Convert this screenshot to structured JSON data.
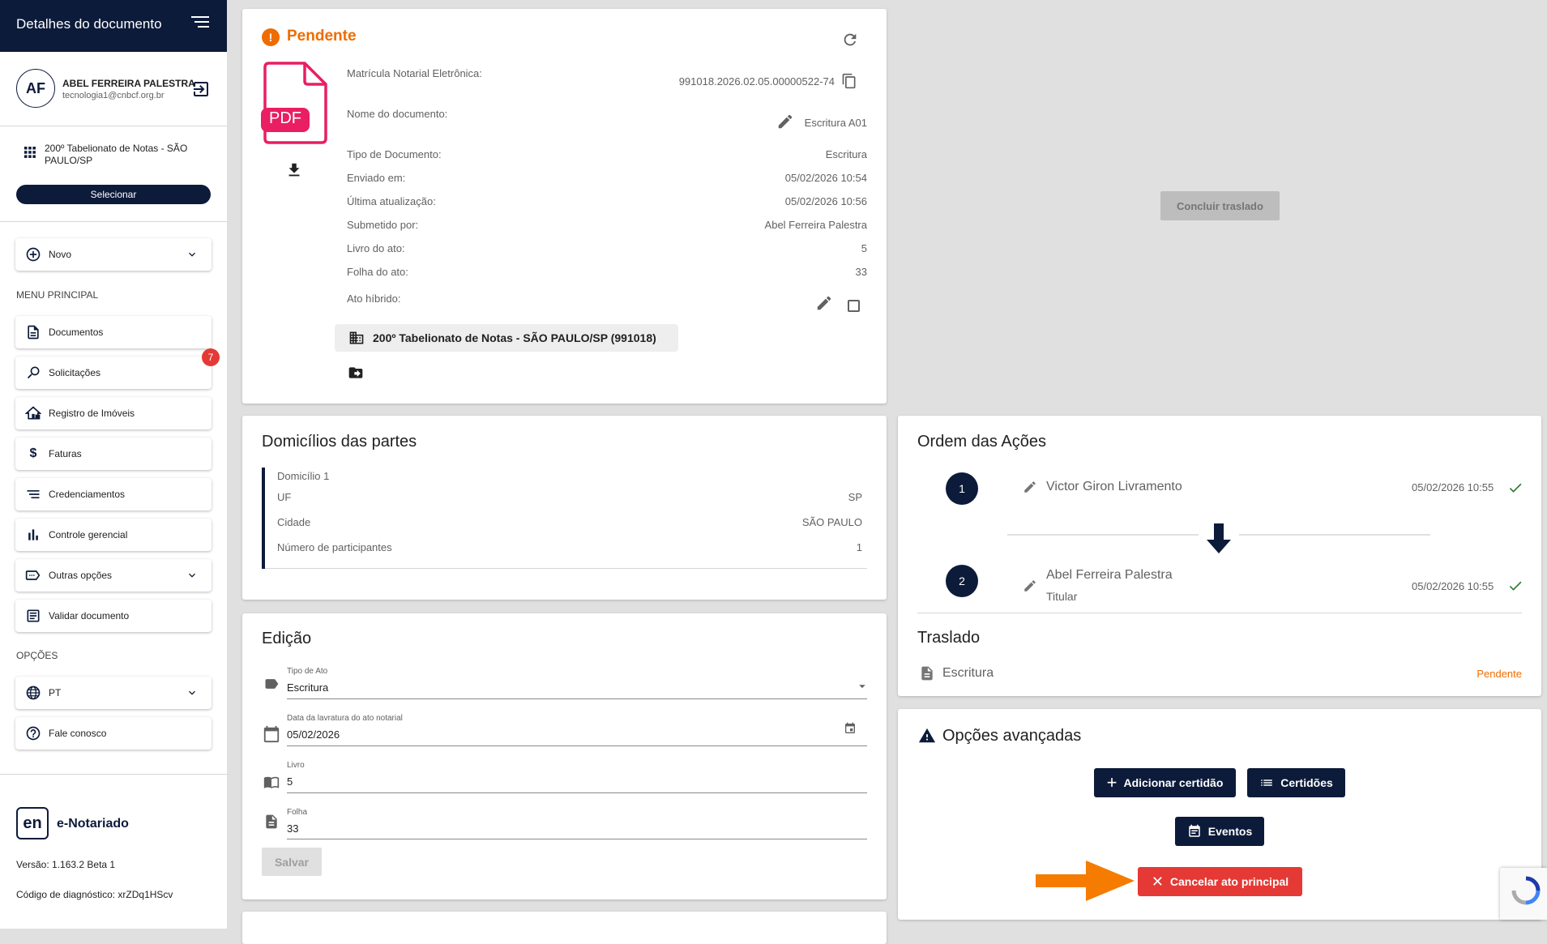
{
  "sidebar": {
    "title": "Detalhes do documento",
    "user": {
      "initials": "AF",
      "name": "ABEL FERREIRA PALESTRA",
      "email": "tecnologia1@cnbcf.org.br"
    },
    "office": "200º Tabelionato de Notas - SÃO PAULO/SP",
    "select_label": "Selecionar",
    "new_label": "Novo",
    "menu_heading": "MENU PRINCIPAL",
    "menu": [
      {
        "label": "Documentos"
      },
      {
        "label": "Solicitações",
        "badge": "7"
      },
      {
        "label": "Registro de Imóveis"
      },
      {
        "label": "Faturas"
      },
      {
        "label": "Credenciamentos"
      },
      {
        "label": "Controle gerencial"
      },
      {
        "label": "Outras opções"
      },
      {
        "label": "Validar documento"
      }
    ],
    "options_heading": "OPÇÕES",
    "language": "PT",
    "contact": "Fale conosco",
    "brand": {
      "logo_text": "en",
      "name": "e-Notariado"
    },
    "version": "Versão: 1.163.2 Beta 1",
    "diagnostic": "Código de diagnóstico: xrZDq1HScv"
  },
  "document": {
    "status": "Pendente",
    "file_type": "PDF",
    "fields": [
      {
        "label": "Matrícula Notarial Eletrônica:",
        "value": "991018.2026.02.05.00000522-74"
      },
      {
        "label": "Nome do documento:",
        "value": "Escritura A01"
      },
      {
        "label": "Tipo de Documento:",
        "value": "Escritura"
      },
      {
        "label": "Enviado em:",
        "value": "05/02/2026 10:54"
      },
      {
        "label": "Última atualização:",
        "value": "05/02/2026 10:56"
      },
      {
        "label": "Submetido por:",
        "value": "Abel Ferreira Palestra"
      },
      {
        "label": "Livro do ato:",
        "value": "5"
      },
      {
        "label": "Folha do ato:",
        "value": "33"
      },
      {
        "label": "Ato híbrido:",
        "value": ""
      }
    ],
    "hybrid_checked": false,
    "office_chip": "200º Tabelionato de Notas - SÃO PAULO/SP (991018)"
  },
  "conclude_label": "Concluir traslado",
  "domicilios": {
    "title": "Domicílios das partes",
    "heading": "Domicílio 1",
    "rows": [
      {
        "label": "UF",
        "value": "SP"
      },
      {
        "label": "Cidade",
        "value": "SÃO PAULO"
      },
      {
        "label": "Número de participantes",
        "value": "1"
      }
    ]
  },
  "edicao": {
    "title": "Edição",
    "fields": [
      {
        "label": "Tipo de Ato",
        "value": "Escritura"
      },
      {
        "label": "Data da lavratura do ato notarial",
        "value": "05/02/2026"
      },
      {
        "label": "Livro",
        "value": "5"
      },
      {
        "label": "Folha",
        "value": "33"
      }
    ],
    "save_label": "Salvar"
  },
  "ordem": {
    "title": "Ordem das Ações",
    "steps": [
      {
        "number": "1",
        "name": "Victor Giron Livramento",
        "role": "",
        "date": "05/02/2026 10:55"
      },
      {
        "number": "2",
        "name": "Abel Ferreira Palestra",
        "role": "Titular",
        "date": "05/02/2026 10:55"
      }
    ],
    "traslado_title": "Traslado",
    "traslado_item": "Escritura",
    "traslado_status": "Pendente"
  },
  "avancadas": {
    "title": "Opções avançadas",
    "add_cert": "Adicionar certidão",
    "certs": "Certidões",
    "events": "Eventos",
    "cancel": "Cancelar ato principal"
  },
  "colors": {
    "navy": "#0d1b3a",
    "orange": "#ef6c00",
    "red": "#e53935",
    "green": "#2e7d32"
  }
}
